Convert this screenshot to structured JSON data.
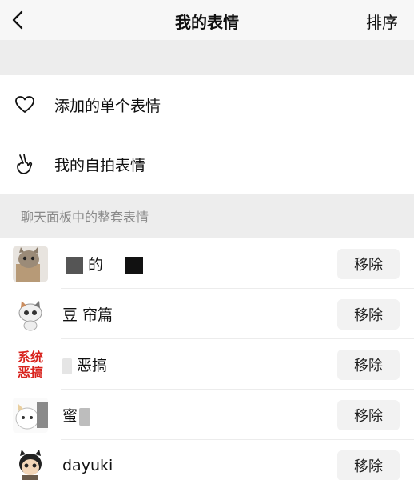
{
  "nav": {
    "title": "我的表情",
    "sort": "排序"
  },
  "menu": {
    "single": "添加的单个表情",
    "selfie": "我的自拍表情"
  },
  "section": {
    "title": "聊天面板中的整套表情"
  },
  "sets": [
    {
      "name": "的",
      "remove": "移除"
    },
    {
      "name": "豆 帘篇",
      "remove": "移除"
    },
    {
      "name": "恶搞",
      "remove": "移除",
      "thumb_text": "系统恶搞"
    },
    {
      "name": "蜜",
      "remove": "移除"
    },
    {
      "name": "dayuki",
      "remove": "移除"
    }
  ]
}
